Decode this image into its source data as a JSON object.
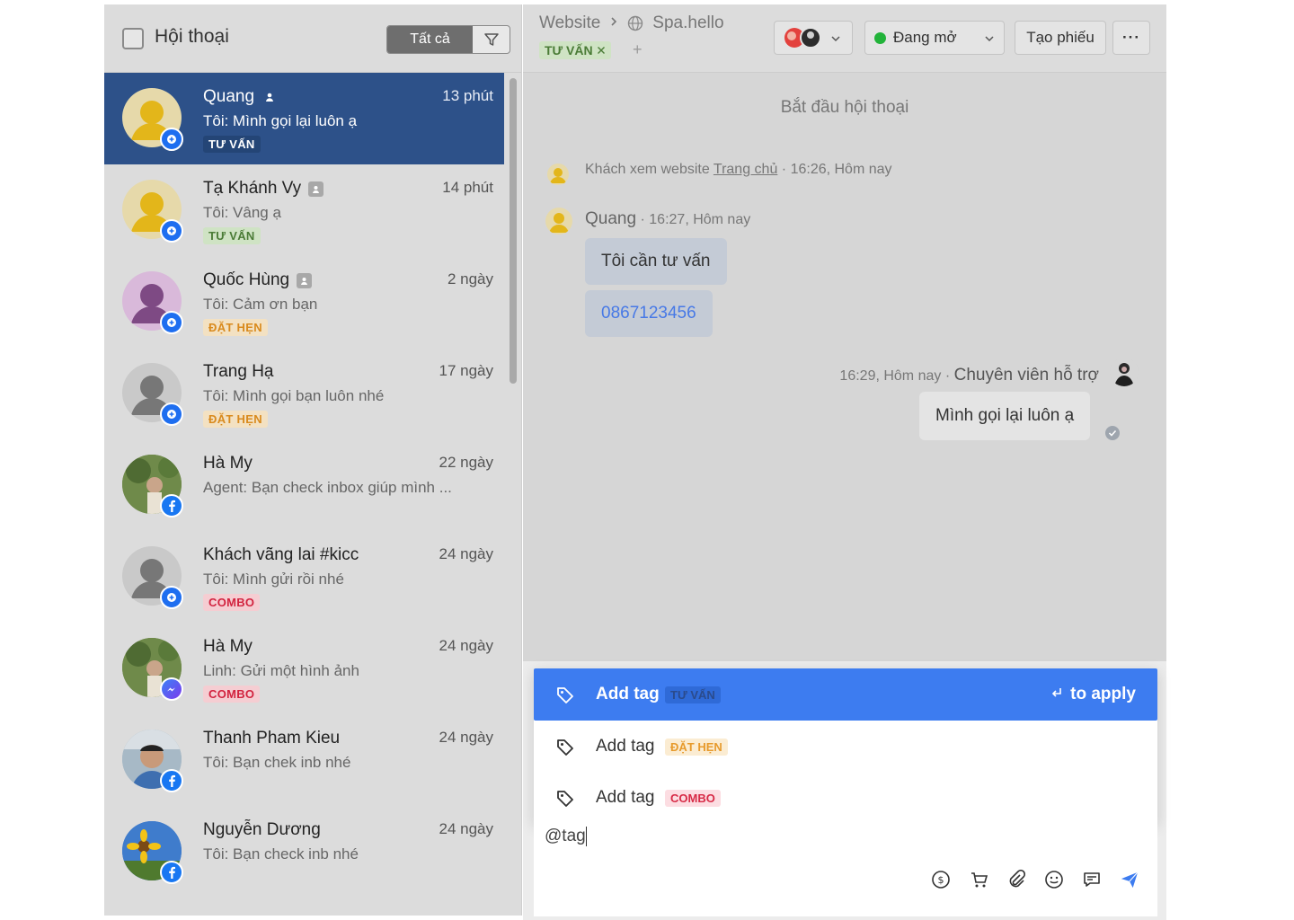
{
  "left": {
    "title": "Hội thoại",
    "filter_all": "Tất cả",
    "conversations": [
      {
        "name": "Quang",
        "time": "13 phút",
        "preview": "Tôi: Mình gọi lại luôn ạ",
        "tag": "TƯ VẤN",
        "channel": "web"
      },
      {
        "name": "Tạ Khánh Vy",
        "time": "14 phút",
        "preview": "Tôi: Vâng ạ",
        "tag": "TƯ VẤN",
        "channel": "web"
      },
      {
        "name": "Quốc Hùng",
        "time": "2 ngày",
        "preview": "Tôi: Cảm ơn bạn",
        "tag": "ĐẶT HẸN",
        "channel": "web"
      },
      {
        "name": "Trang Hạ",
        "time": "17 ngày",
        "preview": "Tôi: Mình gọi bạn luôn nhé",
        "tag": "ĐẶT HẸN",
        "channel": "web"
      },
      {
        "name": "Hà My",
        "time": "22 ngày",
        "preview": "Agent: Bạn check inbox giúp mình ...",
        "tag": "",
        "channel": "facebook"
      },
      {
        "name": "Khách vãng lai #kicc",
        "time": "24 ngày",
        "preview": "Tôi: Mình gửi rồi nhé",
        "tag": "COMBO",
        "channel": "web"
      },
      {
        "name": "Hà My",
        "time": "24 ngày",
        "preview": "Linh: Gửi một hình ảnh",
        "tag": "COMBO",
        "channel": "messenger"
      },
      {
        "name": "Thanh Pham Kieu",
        "time": "24 ngày",
        "preview": "Tôi: Bạn chek inb nhé",
        "tag": "",
        "channel": "facebook"
      },
      {
        "name": "Nguyễn Dương",
        "time": "24 ngày",
        "preview": "Tôi: Bạn check inb nhé",
        "tag": "",
        "channel": "facebook"
      }
    ]
  },
  "header": {
    "breadcrumb_source": "Website",
    "breadcrumb_site": "Spa.hello",
    "tag": "TƯ VẤN",
    "status": "Đang mở",
    "create_ticket": "Tạo phiếu",
    "more": "···"
  },
  "chat": {
    "start": "Bắt đầu hội thoại",
    "visit_text": "Khách xem website",
    "visit_link": "Trang chủ",
    "visit_time": "· 16:26, Hôm nay",
    "customer_name": "Quang",
    "customer_time": "· 16:27, Hôm nay",
    "msg1": "Tôi cần tư vấn",
    "msg2": "0867123456",
    "agent_time": "16:29, Hôm nay ·",
    "agent_name": "Chuyên viên hỗ trợ",
    "msg3": "Mình gọi lại luôn ạ"
  },
  "composer": {
    "text": "@tag",
    "suggestions": [
      {
        "label": "Add tag",
        "tag": "TƯ VẤN",
        "hint": "to apply"
      },
      {
        "label": "Add tag",
        "tag": "ĐẶT HẸN"
      },
      {
        "label": "Add tag",
        "tag": "COMBO"
      }
    ]
  },
  "colors": {
    "active_row": "#2d5189",
    "accent": "#3d7cf0",
    "status_green": "#22b33a"
  }
}
